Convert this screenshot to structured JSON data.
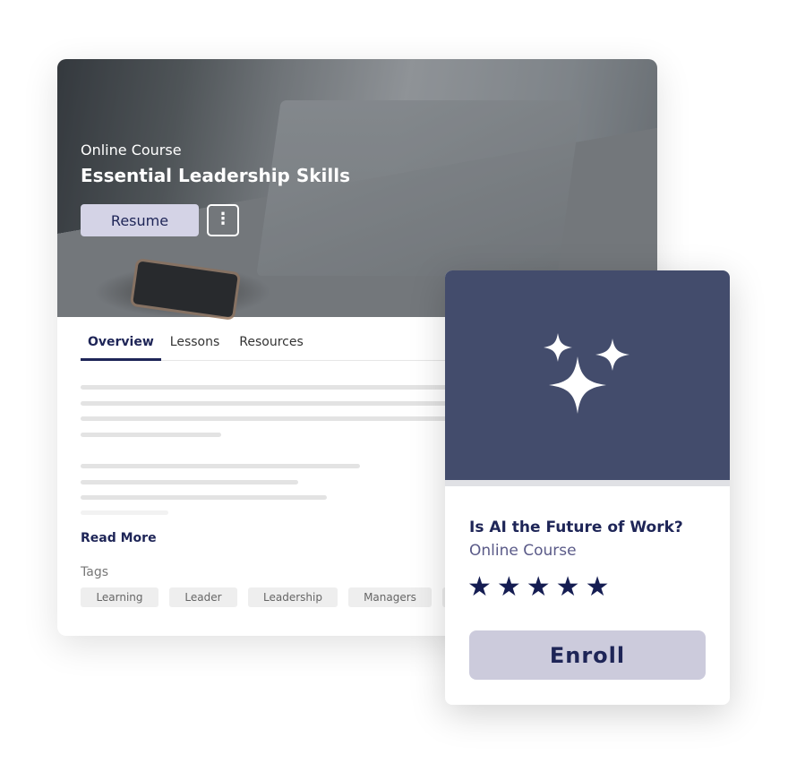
{
  "course": {
    "type": "Online Course",
    "title": "Essential Leadership Skills",
    "resume_label": "Resume",
    "more_icon": "vertical-ellipsis-icon"
  },
  "tabs": [
    {
      "label": "Overview",
      "active": true
    },
    {
      "label": "Lessons"
    },
    {
      "label": "Resources"
    }
  ],
  "read_more": "Read More",
  "tags_label": "Tags",
  "tags": [
    "Learning",
    "Leader",
    "Leadership",
    "Managers"
  ],
  "recommended": {
    "title": "Is AI the Future of Work?",
    "type": "Online Course",
    "rating": 5,
    "rating_max": 5,
    "stars": "★★★★★",
    "enroll_label": "Enroll",
    "icon": "sparkles-icon",
    "header_color": "#434c6c"
  },
  "colors": {
    "accent": "#1e2557",
    "button_bg": "#d4d3e6"
  }
}
